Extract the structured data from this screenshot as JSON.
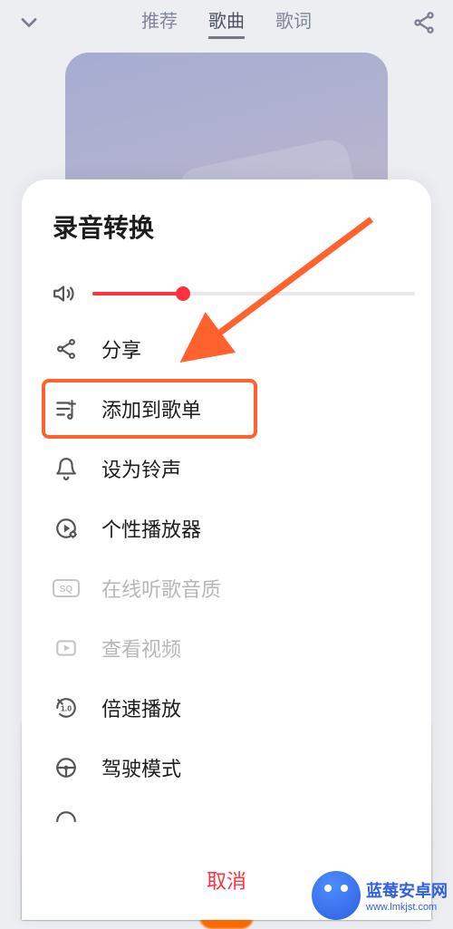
{
  "accent_color": "#ff3040",
  "highlight_color": "#ff622c",
  "tabs": {
    "recommend": "推荐",
    "songs": "歌曲",
    "lyrics": "歌词",
    "active_index": 1
  },
  "sheet": {
    "title": "录音转换",
    "volume_percent": 28,
    "items": [
      {
        "id": "share",
        "icon": "share-icon",
        "label": "分享",
        "disabled": false
      },
      {
        "id": "add_playlist",
        "icon": "playlist-add-icon",
        "label": "添加到歌单",
        "disabled": false,
        "highlighted": true
      },
      {
        "id": "set_ringtone",
        "icon": "bell-icon",
        "label": "设为铃声",
        "disabled": false
      },
      {
        "id": "custom_player",
        "icon": "play-gear-icon",
        "label": "个性播放器",
        "disabled": false
      },
      {
        "id": "online_quality",
        "icon": "sq-icon",
        "label": "在线听歌音质",
        "disabled": true
      },
      {
        "id": "view_video",
        "icon": "play-rect-icon",
        "label": "查看视频",
        "disabled": true
      },
      {
        "id": "playback_speed",
        "icon": "speed-icon",
        "label": "倍速播放",
        "disabled": false
      },
      {
        "id": "driving_mode",
        "icon": "steering-icon",
        "label": "驾驶模式",
        "disabled": false
      },
      {
        "id": "more_cut",
        "icon": "more-icon",
        "label": "",
        "disabled": false
      }
    ],
    "cancel_label": "取消"
  },
  "watermark": {
    "title": "蓝莓安卓网",
    "url": "www.lmkjst.com"
  }
}
